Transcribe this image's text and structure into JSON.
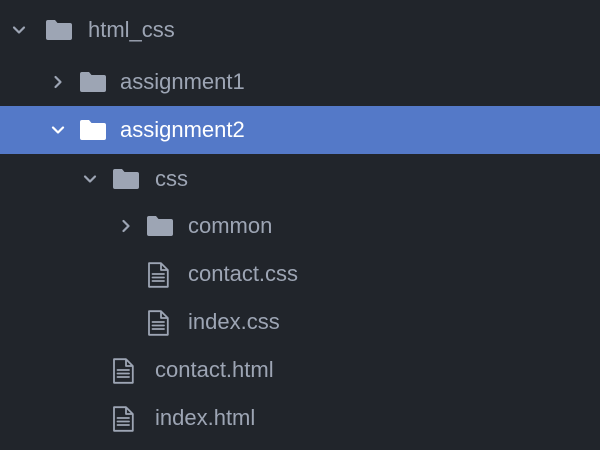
{
  "tree": {
    "root": {
      "label": "html_css",
      "expanded": true,
      "type": "folder"
    },
    "assignment1": {
      "label": "assignment1",
      "expanded": false,
      "type": "folder"
    },
    "assignment2": {
      "label": "assignment2",
      "expanded": true,
      "type": "folder",
      "selected": true
    },
    "css": {
      "label": "css",
      "expanded": true,
      "type": "folder"
    },
    "common": {
      "label": "common",
      "expanded": false,
      "type": "folder"
    },
    "contact_css": {
      "label": "contact.css",
      "type": "file"
    },
    "index_css": {
      "label": "index.css",
      "type": "file"
    },
    "contact_html": {
      "label": "contact.html",
      "type": "file"
    },
    "index_html": {
      "label": "index.html",
      "type": "file"
    }
  },
  "colors": {
    "background": "#21252b",
    "selection": "#5479c8",
    "text": "#9da5b4",
    "selected_text": "#ffffff"
  },
  "icons": {
    "expanded": "chevron-down-icon",
    "collapsed": "chevron-right-icon",
    "folder": "folder-icon",
    "file": "file-icon"
  }
}
